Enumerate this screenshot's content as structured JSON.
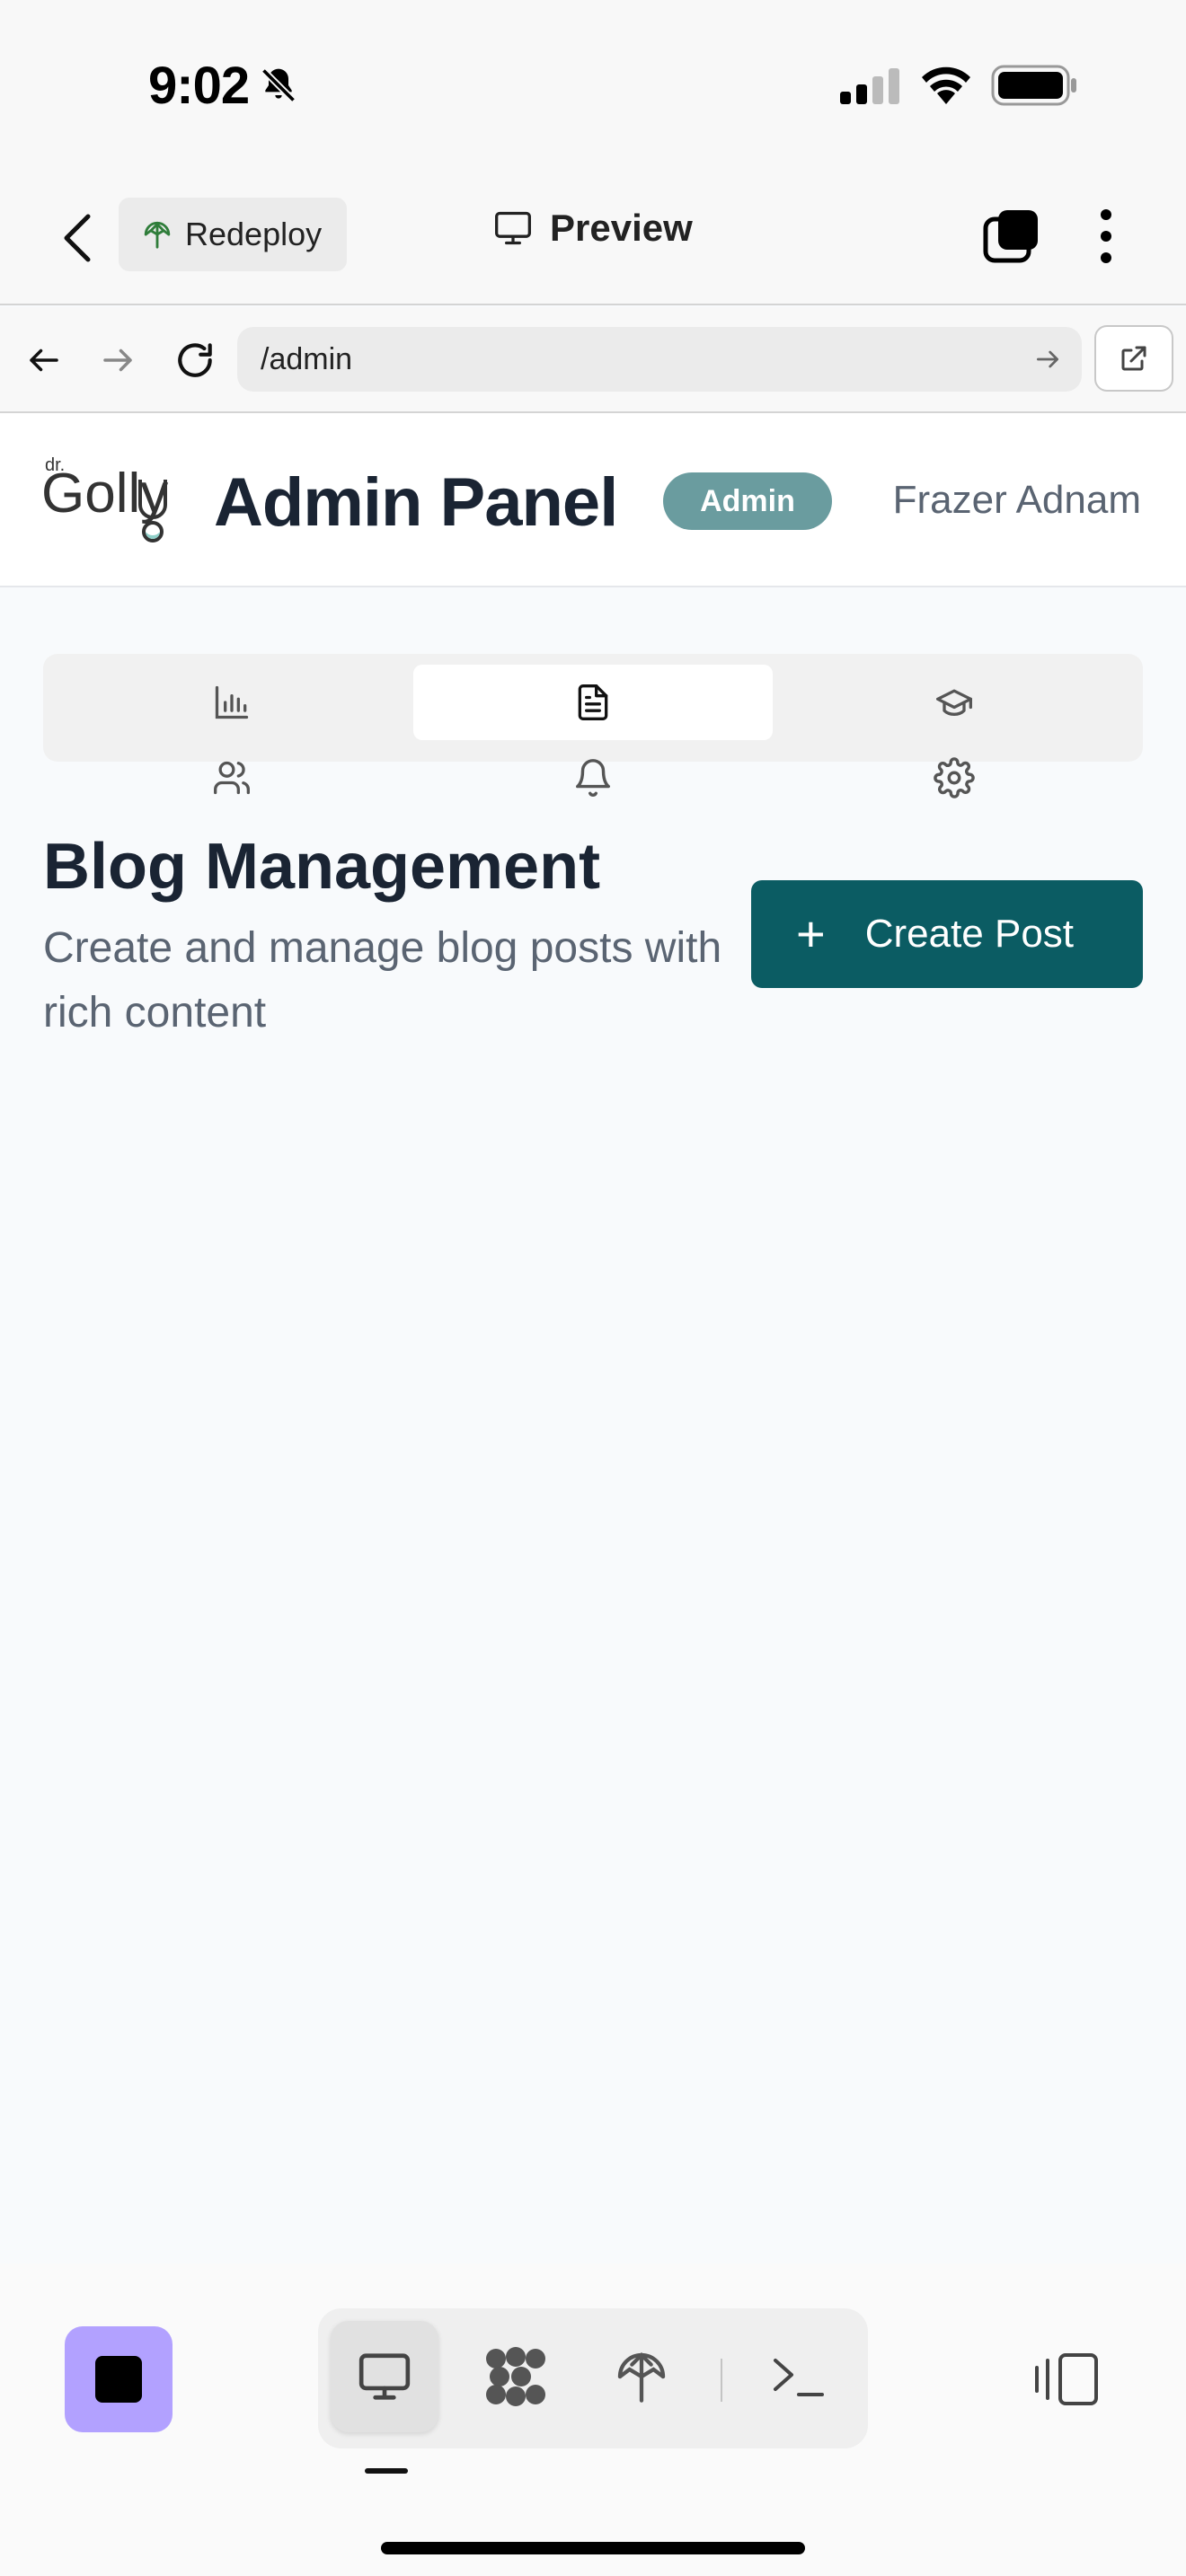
{
  "status_bar": {
    "time": "9:02"
  },
  "toolbar": {
    "redeploy_label": "Redeploy",
    "preview_label": "Preview"
  },
  "browser": {
    "url": "/admin"
  },
  "app": {
    "logo_text_small": "dr.",
    "logo_text": "Golly",
    "title": "Admin Panel",
    "role_badge": "Admin",
    "user_name": "Frazer Adnam",
    "tabs": [
      {
        "icon": "bar-chart-icon",
        "active": false
      },
      {
        "icon": "document-icon",
        "active": true
      },
      {
        "icon": "graduation-cap-icon",
        "active": false
      },
      {
        "icon": "users-icon",
        "active": false
      },
      {
        "icon": "bell-icon",
        "active": false
      },
      {
        "icon": "settings-icon",
        "active": false
      }
    ],
    "section_title": "Blog Management",
    "section_description": "Create and manage blog posts with rich content",
    "create_button_label": "Create Post",
    "create_button_icon": "plus-icon"
  },
  "bottom_toolbar": {
    "items": [
      "desktop-icon",
      "agent-icon",
      "deploy-icon",
      "terminal-icon"
    ],
    "active": "desktop-icon"
  },
  "colors": {
    "primary": "#0b5c63",
    "badge": "#6a9c9f",
    "stop_button": "#b2a1ff"
  }
}
